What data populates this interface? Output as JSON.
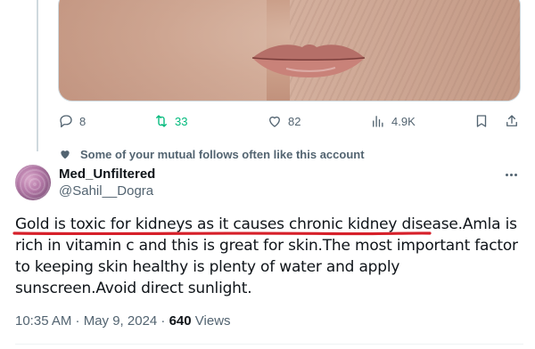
{
  "quoted_media": {
    "icon": "photo-of-lips-and-skin"
  },
  "actions": {
    "replies": "8",
    "retweets": "33",
    "likes": "82",
    "views": "4.9K",
    "colors": {
      "default": "#536471",
      "retweet": "#00ba7c"
    }
  },
  "social_context": {
    "text": "Some of your mutual follows often like this account",
    "icon": "heart-icon"
  },
  "tweet": {
    "display_name": "Med_Unfiltered",
    "handle": "@Sahil__Dogra",
    "text_underlined": "Gold is toxic for kidneys as it causes chronic kidney disease.",
    "text_rest": "Amla is rich in vitamin c and this is great for skin.The most important factor to keeping skin healthy is plenty of water and apply sunscreen.Avoid direct sunlight.",
    "annotation_color": "#d6202a",
    "time": "10:35 AM · May 9, 2024 · ",
    "view_count": "640",
    "views_label": " Views"
  }
}
